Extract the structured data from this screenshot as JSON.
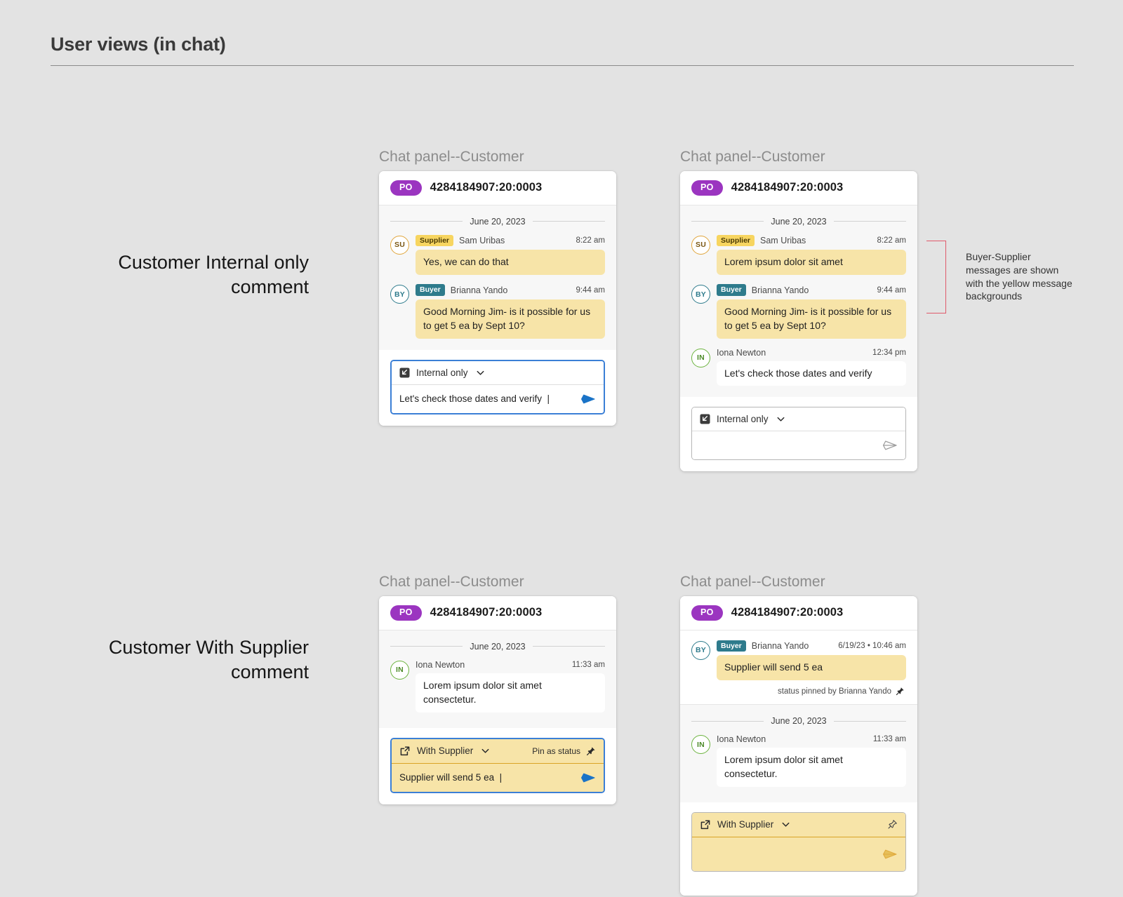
{
  "page": {
    "title": "User views (in chat)"
  },
  "row_labels": {
    "internal": "Customer Internal only comment",
    "supplier": "Customer With Supplier comment"
  },
  "annotation": {
    "text": "Buyer-Supplier messages are shown with the yellow message backgrounds",
    "bracket_color": "#e05a6b"
  },
  "colors": {
    "po_badge": "#9b35c0",
    "supplier_badge": "#f7d560",
    "buyer_badge": "#2e7b8c",
    "yellow_bubble": "#f7e4a8",
    "send_active": "#1a73c7",
    "send_inactive": "#9e9e9e",
    "send_yellow": "#e0a93c",
    "focus_border": "#3b7fd6"
  },
  "panels": [
    {
      "id": "top-left",
      "caption": "Chat panel--Customer",
      "header": {
        "badge": "PO",
        "po_number": "4284184907:20:0003"
      },
      "date_separator": "June 20, 2023",
      "messages": [
        {
          "avatar": "SU",
          "avatar_kind": "supplier",
          "role_badge": "Supplier",
          "role_kind": "supplier",
          "author": "Sam Uribas",
          "time": "8:22 am",
          "text": "Yes, we can do that",
          "bubble": "yellow"
        },
        {
          "avatar": "BY",
          "avatar_kind": "buyer",
          "role_badge": "Buyer",
          "role_kind": "buyer",
          "author": "Brianna Yando",
          "time": "9:44 am",
          "text": "Good Morning Jim- is it possible for us to get 5 ea by Sept 10?",
          "bubble": "yellow"
        }
      ],
      "composer": {
        "mode_label": "Internal only",
        "mode_icon": "internal-reply-icon",
        "chevron_icon": "chevron-down-icon",
        "draft_value": "Let's check those dates and verify",
        "placeholder": "",
        "has_cursor": true,
        "send_icon": "send-icon",
        "send_state": "active",
        "focused": true,
        "style": "white",
        "pin_label": "",
        "show_pin": false
      }
    },
    {
      "id": "top-right",
      "caption": "Chat panel--Customer",
      "header": {
        "badge": "PO",
        "po_number": "4284184907:20:0003"
      },
      "date_separator": "June 20, 2023",
      "messages": [
        {
          "avatar": "SU",
          "avatar_kind": "supplier",
          "role_badge": "Supplier",
          "role_kind": "supplier",
          "author": "Sam Uribas",
          "time": "8:22 am",
          "text": "Lorem ipsum dolor sit amet",
          "bubble": "yellow"
        },
        {
          "avatar": "BY",
          "avatar_kind": "buyer",
          "role_badge": "Buyer",
          "role_kind": "buyer",
          "author": "Brianna Yando",
          "time": "9:44 am",
          "text": "Good Morning Jim- is it possible for us to get 5 ea by Sept 10?",
          "bubble": "yellow"
        },
        {
          "avatar": "IN",
          "avatar_kind": "internal",
          "role_badge": "",
          "role_kind": "none",
          "author": "Iona Newton",
          "time": "12:34 pm",
          "text": "Let's check those dates and verify",
          "bubble": "white"
        }
      ],
      "composer": {
        "mode_label": "Internal only",
        "mode_icon": "internal-reply-icon",
        "chevron_icon": "chevron-down-icon",
        "draft_value": "",
        "placeholder": "",
        "has_cursor": false,
        "send_icon": "send-icon",
        "send_state": "inactive",
        "focused": false,
        "style": "white",
        "pin_label": "",
        "show_pin": false
      }
    },
    {
      "id": "bottom-left",
      "caption": "Chat panel--Customer",
      "header": {
        "badge": "PO",
        "po_number": "4284184907:20:0003"
      },
      "date_separator": "June 20, 2023",
      "messages": [
        {
          "avatar": "IN",
          "avatar_kind": "internal",
          "role_badge": "",
          "role_kind": "none",
          "author": "Iona Newton",
          "time": "11:33 am",
          "text": "Lorem ipsum dolor sit amet consectetur.",
          "bubble": "white"
        }
      ],
      "composer": {
        "mode_label": "With Supplier",
        "mode_icon": "external-link-icon",
        "chevron_icon": "chevron-down-icon",
        "draft_value": "Supplier will send 5 ea",
        "placeholder": "",
        "has_cursor": true,
        "send_icon": "send-icon",
        "send_state": "active",
        "focused": true,
        "style": "yellow",
        "pin_label": "Pin as status",
        "pin_icon": "pin-icon",
        "show_pin": true
      }
    },
    {
      "id": "bottom-right",
      "caption": "Chat panel--Customer",
      "header": {
        "badge": "PO",
        "po_number": "4284184907:20:0003"
      },
      "pinned_block": {
        "avatar": "BY",
        "avatar_kind": "buyer",
        "role_badge": "Buyer",
        "role_kind": "buyer",
        "author": "Brianna Yando",
        "time": "6/19/23 • 10:46 am",
        "text": "Supplier will send 5 ea",
        "bubble": "yellow",
        "pinned_note": "status pinned by Brianna Yando",
        "pinned_icon": "pin-icon"
      },
      "date_separator": "June 20, 2023",
      "messages": [
        {
          "avatar": "IN",
          "avatar_kind": "internal",
          "role_badge": "",
          "role_kind": "none",
          "author": "Iona Newton",
          "time": "11:33 am",
          "text": "Lorem ipsum dolor sit amet consectetur.",
          "bubble": "white"
        }
      ],
      "composer": {
        "mode_label": "With Supplier",
        "mode_icon": "external-link-icon",
        "chevron_icon": "chevron-down-icon",
        "draft_value": "",
        "placeholder": "",
        "has_cursor": false,
        "send_icon": "send-icon",
        "send_state": "yellow-inactive",
        "focused": false,
        "style": "yellow",
        "pin_label": "",
        "pin_icon": "pin-outline-icon",
        "show_pin": true
      }
    }
  ]
}
